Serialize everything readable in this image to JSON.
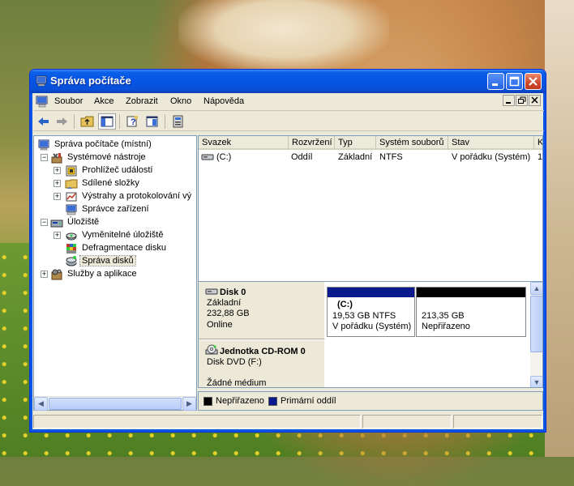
{
  "window": {
    "title": "Správa počítače"
  },
  "menu": {
    "items": [
      "Soubor",
      "Akce",
      "Zobrazit",
      "Okno",
      "Nápověda"
    ]
  },
  "toolbar": {
    "buttons": [
      "back",
      "forward",
      "up-folder",
      "show-hide-tree",
      "help",
      "properties",
      "computer-management"
    ]
  },
  "tree": {
    "items": [
      {
        "label": "Správa počítače (místní)",
        "icon": "computer-icon"
      },
      {
        "label": "Systémové nástroje",
        "icon": "tools-icon"
      },
      {
        "label": "Prohlížeč událostí",
        "icon": "event-viewer-icon"
      },
      {
        "label": "Sdílené složky",
        "icon": "shared-folder-icon"
      },
      {
        "label": "Výstrahy a protokolování vý",
        "icon": "alerts-icon"
      },
      {
        "label": "Správce zařízení",
        "icon": "device-manager-icon"
      },
      {
        "label": "Úložiště",
        "icon": "storage-icon"
      },
      {
        "label": "Vyměnitelné úložiště",
        "icon": "removable-storage-icon"
      },
      {
        "label": "Defragmentace disku",
        "icon": "defrag-icon"
      },
      {
        "label": "Správa disků",
        "icon": "disk-management-icon"
      },
      {
        "label": "Služby a aplikace",
        "icon": "services-icon"
      }
    ],
    "selected": "Správa disků"
  },
  "volume_list": {
    "columns": [
      "Svazek",
      "Rozvržení",
      "Typ",
      "Systém souborů",
      "Stav",
      "K"
    ],
    "rows": [
      {
        "volume": "(C:)",
        "layout": "Oddíl",
        "type": "Základní",
        "fs": "NTFS",
        "status": "V pořádku (Systém)",
        "capacity": "1"
      }
    ]
  },
  "disks": [
    {
      "name": "Disk 0",
      "type": "Základní",
      "size": "232,88 GB",
      "state": "Online",
      "partitions": [
        {
          "name": "(C:)",
          "size": "19,53 GB NTFS",
          "status": "V pořádku (Systém)",
          "color": "#0a1a8c"
        },
        {
          "name": "",
          "size": "213,35 GB",
          "status": "Nepřiřazeno",
          "color": "#000000"
        }
      ]
    },
    {
      "name": "Jednotka CD-ROM 0",
      "type": "Disk DVD (F:)",
      "state": "Žádné médium"
    }
  ],
  "legend": {
    "unallocated": "Nepřiřazeno",
    "primary": "Primární oddíl",
    "unallocated_color": "#000000",
    "primary_color": "#0a1a8c"
  }
}
